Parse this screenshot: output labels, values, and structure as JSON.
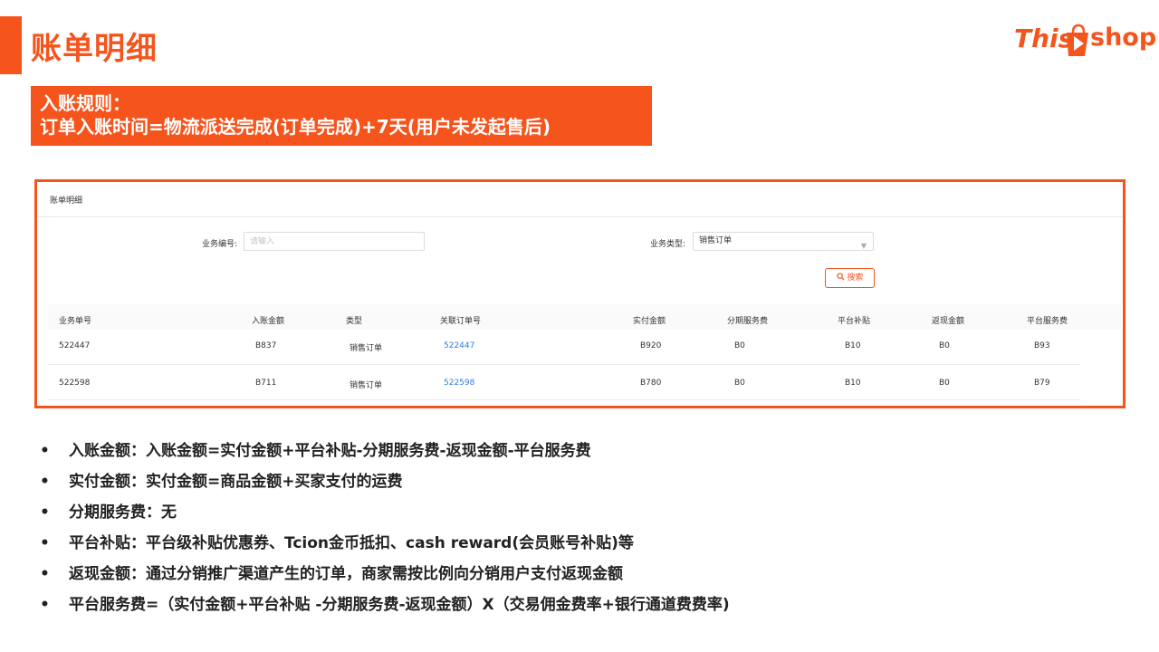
{
  "slide": {
    "title": "账单明细",
    "rule_line1": "入账规则：",
    "rule_line2": "订单入账时间=物流派送完成(订单完成)+7天(用户未发起售后)"
  },
  "logo": {
    "left_text": "This",
    "right_text": "shop"
  },
  "colors": {
    "accent": "#f5541d",
    "link": "#2f7de1"
  },
  "panel": {
    "title": "账单明细",
    "filters": {
      "business_no_label": "业务编号:",
      "business_no_placeholder": "请输入",
      "business_type_label": "业务类型:",
      "business_type_value": "销售订单"
    },
    "search_button": "搜索",
    "table": {
      "columns": [
        "业务单号",
        "入账金额",
        "类型",
        "关联订单号",
        "实付金额",
        "分期服务费",
        "平台补贴",
        "返现金额",
        "平台服务费"
      ],
      "rows": [
        [
          "522447",
          "B837",
          "销售订单",
          "522447",
          "B920",
          "B0",
          "B10",
          "B0",
          "B93"
        ],
        [
          "522598",
          "B711",
          "销售订单",
          "522598",
          "B780",
          "B0",
          "B10",
          "B0",
          "B79"
        ]
      ]
    }
  },
  "bullets": [
    "入账金额：入账金额=实付金额+平台补贴-分期服务费-返现金额-平台服务费",
    "实付金额：实付金额=商品金额+买家支付的运费",
    "分期服务费：无",
    "平台补贴：平台级补贴优惠券、Tcion金币抵扣、cash reward(会员账号补贴)等",
    "返现金额：通过分销推广渠道产生的订单，商家需按比例向分销用户支付返现金额",
    "平台服务费=（实付金额+平台补贴 -分期服务费-返现金额）X（交易佣金费率+银行通道费费率)"
  ]
}
